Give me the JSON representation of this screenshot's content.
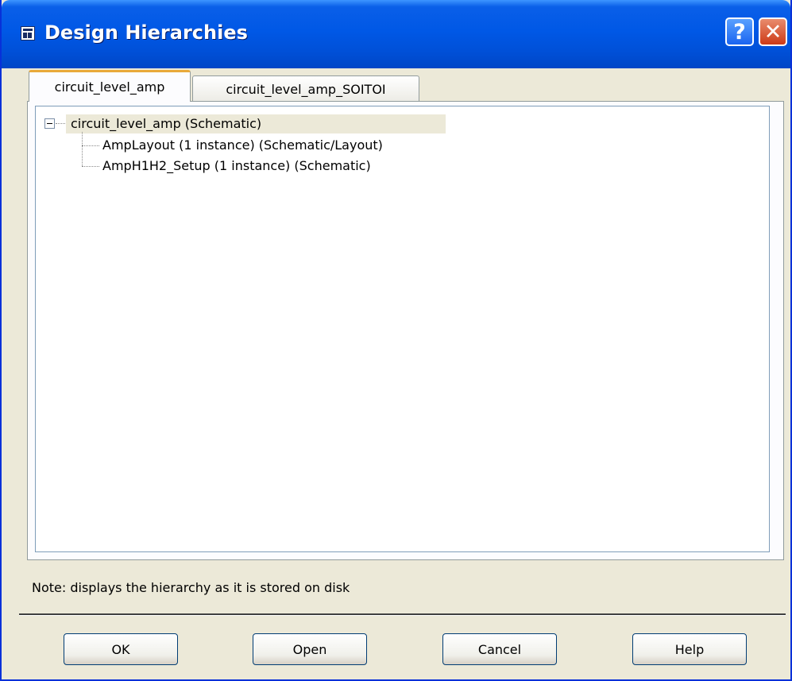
{
  "window": {
    "title": "Design Hierarchies",
    "help_label": "?",
    "close_label": "✕"
  },
  "icons": {
    "window_icon": "hierarchy-window-icon",
    "help": "help-icon",
    "close": "close-icon",
    "expander": "minus-box-icon"
  },
  "tabs": [
    {
      "label": "circuit_level_amp",
      "active": true
    },
    {
      "label": "circuit_level_amp_SOITOI",
      "active": false
    }
  ],
  "tree": {
    "root": {
      "label": "circuit_level_amp (Schematic)",
      "expanded": true
    },
    "children": [
      {
        "label": "AmpLayout (1 instance) (Schematic/Layout)"
      },
      {
        "label": "AmpH1H2_Setup (1 instance) (Schematic)"
      }
    ]
  },
  "note": "Note: displays the hierarchy as it is stored on disk",
  "buttons": {
    "ok": "OK",
    "open": "Open",
    "cancel": "Cancel",
    "help": "Help"
  }
}
